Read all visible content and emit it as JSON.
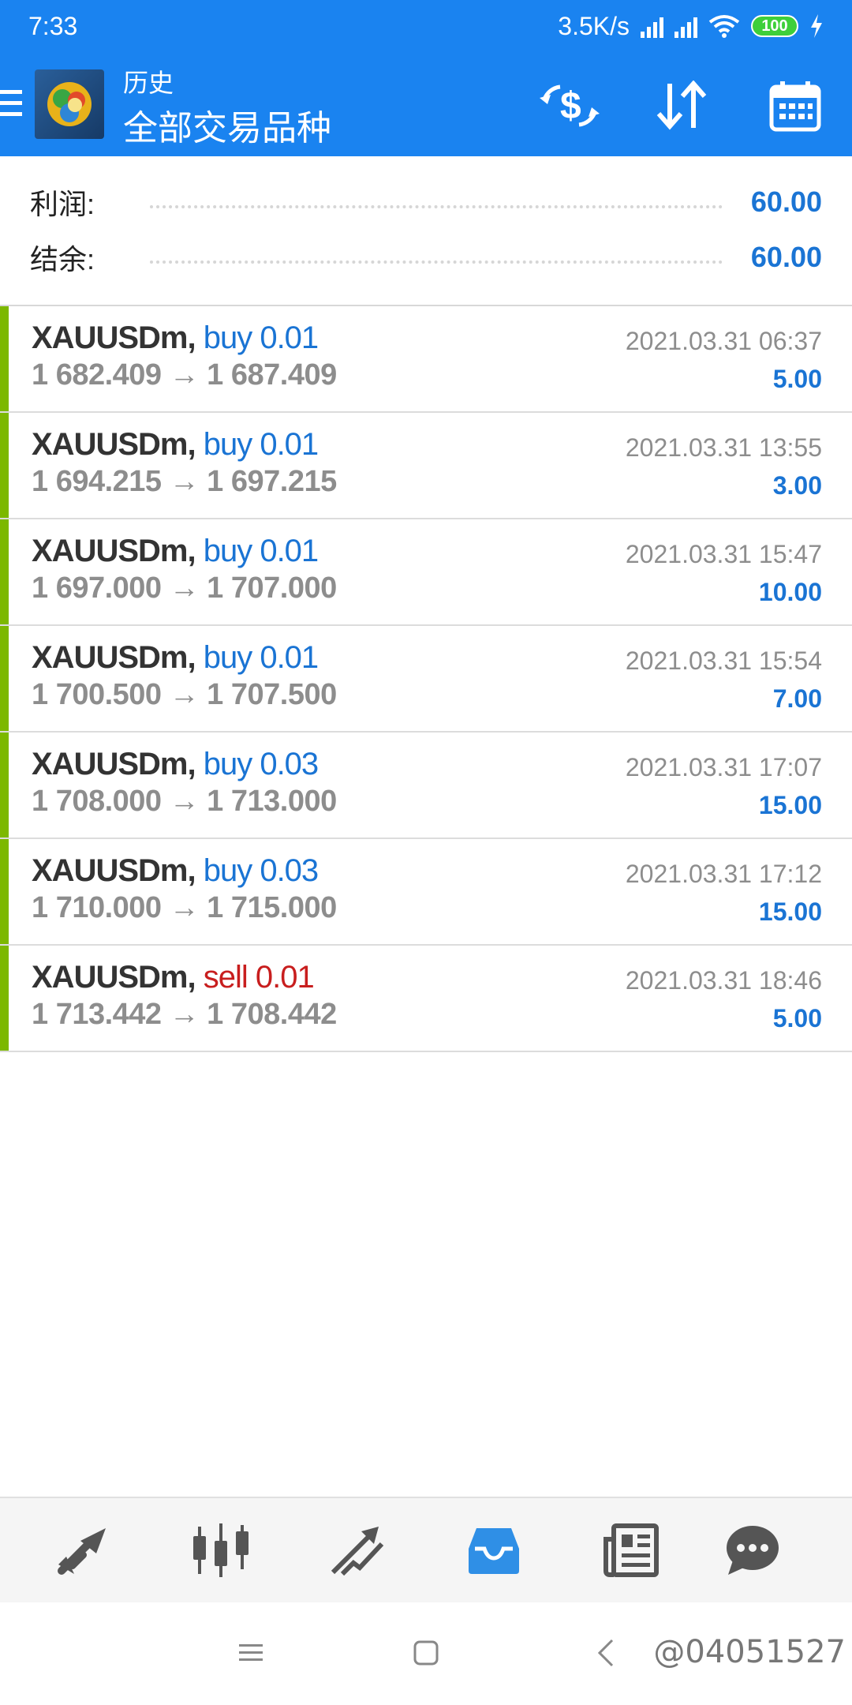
{
  "status": {
    "time": "7:33",
    "speed": "3.5K/s",
    "battery": "100"
  },
  "header": {
    "title_small": "历史",
    "title_large": "全部交易品种"
  },
  "summary": {
    "profit_label": "利润:",
    "profit_value": "60.00",
    "balance_label": "结余:",
    "balance_value": "60.00"
  },
  "trades": [
    {
      "symbol": "XAUUSDm,",
      "side": "buy 0.01",
      "prices": "1 682.409 → 1 687.409",
      "time": "2021.03.31 06:37",
      "profit": "5.00"
    },
    {
      "symbol": "XAUUSDm,",
      "side": "buy 0.01",
      "prices": "1 694.215 → 1 697.215",
      "time": "2021.03.31 13:55",
      "profit": "3.00"
    },
    {
      "symbol": "XAUUSDm,",
      "side": "buy 0.01",
      "prices": "1 697.000 → 1 707.000",
      "time": "2021.03.31 15:47",
      "profit": "10.00"
    },
    {
      "symbol": "XAUUSDm,",
      "side": "buy 0.01",
      "prices": "1 700.500 → 1 707.500",
      "time": "2021.03.31 15:54",
      "profit": "7.00"
    },
    {
      "symbol": "XAUUSDm,",
      "side": "buy 0.03",
      "prices": "1 708.000 → 1 713.000",
      "time": "2021.03.31 17:07",
      "profit": "15.00"
    },
    {
      "symbol": "XAUUSDm,",
      "side": "buy 0.03",
      "prices": "1 710.000 → 1 715.000",
      "time": "2021.03.31 17:12",
      "profit": "15.00"
    },
    {
      "symbol": "XAUUSDm,",
      "side": "sell 0.01",
      "prices": "1 713.442 → 1 708.442",
      "time": "2021.03.31 18:46",
      "profit": "5.00"
    }
  ],
  "bottom_nav": {
    "items": [
      "quotes-icon",
      "chart-icon",
      "trade-icon",
      "history-icon",
      "news-icon",
      "chat-icon"
    ],
    "active": "history-icon"
  },
  "watermark": "@04051527",
  "colors": {
    "primary": "#1a83f0",
    "buy": "#1a74d4",
    "sell": "#c81e1e",
    "profit_bar": "#7cb800"
  }
}
